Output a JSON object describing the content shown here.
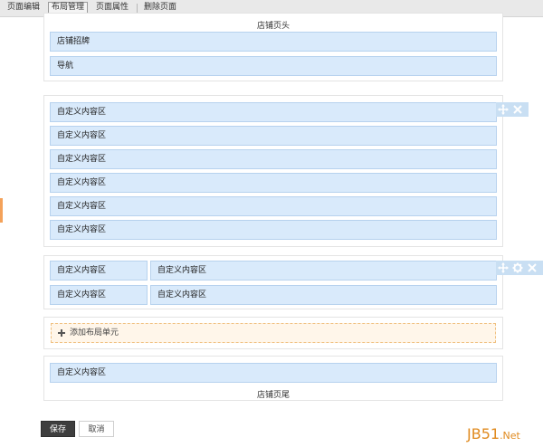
{
  "toolbar": {
    "items": [
      {
        "label": "页面编辑",
        "active": false
      },
      {
        "label": "布局管理",
        "active": true
      },
      {
        "label": "页面属性",
        "active": false
      },
      {
        "label": "删除页面",
        "active": false
      }
    ]
  },
  "header_section": {
    "title": "店铺页头",
    "modules": [
      "店铺招牌",
      "导航"
    ]
  },
  "section_single": {
    "modules": [
      "自定义内容区",
      "自定义内容区",
      "自定义内容区",
      "自定义内容区",
      "自定义内容区",
      "自定义内容区"
    ]
  },
  "section_two_col": {
    "rows": [
      {
        "left": "自定义内容区",
        "right": "自定义内容区"
      },
      {
        "left": "自定义内容区",
        "right": "自定义内容区"
      }
    ]
  },
  "add_unit": {
    "label": "添加布局单元"
  },
  "footer_section": {
    "module": "自定义内容区",
    "title": "店铺页尾"
  },
  "buttons": {
    "save": "保存",
    "cancel": "取消"
  },
  "watermark": {
    "main": "JB51",
    "suffix": ".Net"
  },
  "colors": {
    "module_bg": "#d9eafb",
    "module_border": "#b7d2ee",
    "add_unit_border": "#f0c080",
    "accent_orange": "#f4a25a",
    "watermark": "#e08a1e"
  }
}
